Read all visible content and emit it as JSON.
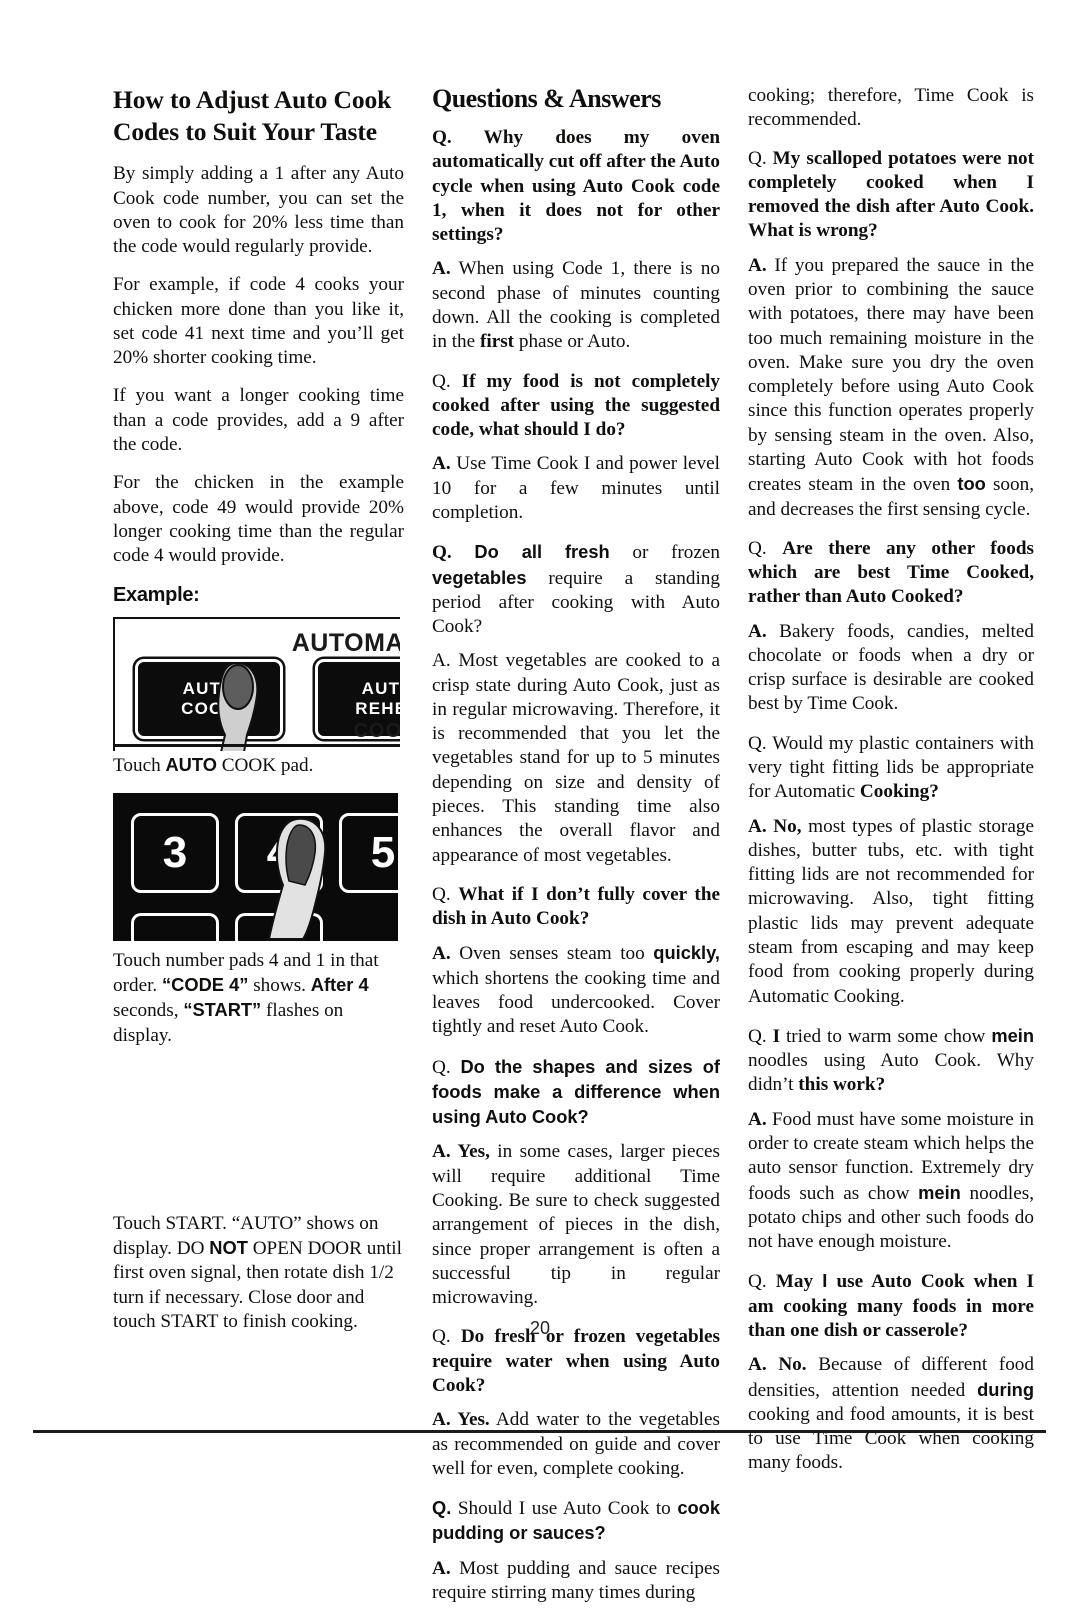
{
  "page": {
    "number": "20"
  },
  "left_column": {
    "heading": "How to Adjust Auto Cook Codes to Suit Your Taste",
    "paragraphs": [
      "By simply adding a 1 after any Auto Cook code number, you can set the oven to cook for 20% less time than the code would regularly provide.",
      "For example, if code 4 cooks your chicken more done than you like it, set code 41 next time and you’ll get 20% shorter cooking time.",
      "If you want a longer cooking time than a code provides, add a 9 after the code.",
      "For the chicken in the example above, code 49 would provide 20% longer cooking time than the regular code 4 would provide."
    ],
    "example_heading": "Example:",
    "photo1": {
      "panel_label_top": "AUTOMA",
      "panel_label_bottom": "COO",
      "pad_auto_cook_line1": "AUTO",
      "pad_auto_cook_line2": "COOK",
      "pad_auto_reheat_line1": "AUTO",
      "pad_auto_reheat_line2": "REHEA"
    },
    "caption1_part1": "Touch ",
    "caption1_bold": "AUTO",
    "caption1_part2": " COOK pad.",
    "photo2": {
      "pad3": "3",
      "pad4": "4",
      "pad5": "5"
    },
    "caption2_part1": "Touch number pads 4 and 1 in that order. ",
    "caption2_bold1": "“CODE 4”",
    "caption2_part2": " shows. ",
    "caption2_bold2": "After 4",
    "caption2_part3": " seconds, ",
    "caption2_bold3": "“START”",
    "caption2_part4": " flashes on display.",
    "final_part1": "Touch START. “AUTO” shows on display. DO ",
    "final_bold": "NOT",
    "final_part2": " OPEN DOOR until first oven signal, then rotate dish 1/2 turn if necessary. Close door and touch START to finish cooking."
  },
  "middle_column": {
    "heading": "Questions & Answers",
    "qa": [
      {
        "q_prefix": "Q. ",
        "q_text": "Why does my oven automatically cut off after the Auto cycle when using Auto Cook code 1, when it does not for other settings?",
        "a_prefix": "A.",
        "a_part1": " When using Code 1, there is no second phase of minutes counting down. All the cooking is completed in the ",
        "a_bold": "first",
        "a_part2": " phase or Auto."
      },
      {
        "q_prefix": "Q. ",
        "q_text": "If my food is not completely cooked after using the suggested code, what should I do?",
        "a_prefix": "A.",
        "a_part1": " Use Time Cook I and power level 10 for a few minutes until completion."
      },
      {
        "q_prefix": "Q. ",
        "q_bold1": "Do all fresh",
        "q_reg1": " or frozen ",
        "q_bold2": "vegetables",
        "q_reg2": " require a standing period after cooking with Auto Cook?",
        "a_text": "A. Most vegetables are cooked to a crisp state during Auto Cook, just as in regular microwaving. Therefore, it is recommended that you let the vegetables stand for up to 5 minutes depending on size and density of pieces. This standing time also enhances the overall flavor and appearance of most vegetables."
      },
      {
        "q_prefix": "Q. ",
        "q_text": "What if I don’t fully cover the dish in Auto Cook?",
        "a_prefix": "A.",
        "a_part1": " Oven senses steam too ",
        "a_bold": "quickly,",
        "a_part2": " which shortens the cooking time and leaves food undercooked. Cover tightly and reset Auto Cook."
      },
      {
        "q_prefix": "Q. ",
        "q_text": "Do the shapes and sizes of foods make a difference when using Auto Cook?",
        "a_prefix": "A. Yes,",
        "a_part1": " in some cases, larger pieces will require additional Time Cooking. Be sure to check suggested arrangement of pieces in the dish, since proper arrangement is often a successful tip in regular microwaving."
      },
      {
        "q_prefix": "Q. ",
        "q_text": "Do fresh or frozen vegetables require water when using Auto Cook?",
        "a_prefix": "A. Yes.",
        "a_part1": " Add water to the vegetables as recommended on guide and cover well for even, complete cooking."
      },
      {
        "q_prefix": "Q.",
        "q_reg1": " Should I use Auto Cook to ",
        "q_bold2": "cook pudding or sauces?",
        "a_prefix": "A.",
        "a_part1": " Most pudding and sauce recipes require stirring many times during"
      }
    ]
  },
  "right_column": {
    "continued": "cooking; therefore, Time Cook is recommended.",
    "qa": [
      {
        "q_prefix": "Q. ",
        "q_text": "My scalloped potatoes were not completely cooked when I removed the dish after Auto Cook. What is wrong?",
        "a_prefix": "A.",
        "a_part1": " If you prepared the sauce in the oven prior to combining the sauce with potatoes, there may have been too much remaining moisture in the oven. Make sure you dry the oven completely before using Auto Cook since this function operates properly by sensing steam in the oven. Also, starting Auto Cook with hot foods creates steam in the oven ",
        "a_bold": "too",
        "a_part2": " soon, and decreases the first sensing cycle."
      },
      {
        "q_prefix": "Q. ",
        "q_text": "Are there any other foods which are best Time Cooked, rather than Auto Cooked?",
        "a_prefix": "A.",
        "a_part1": " Bakery foods, candies, melted chocolate or foods when a dry or crisp surface is desirable are cooked best by Time Cook."
      },
      {
        "q_prefix": "Q.",
        "q_reg1": " Would my plastic containers with very tight fitting lids be appropriate for Automatic ",
        "q_bold2": "Cooking?",
        "a_prefix": "A. No,",
        "a_part1": " most types of plastic storage dishes, butter tubs, etc. with tight fitting lids are not recommended for microwaving. Also, tight fitting plastic lids may prevent adequate steam from escaping and may keep food from cooking properly during Automatic Cooking."
      },
      {
        "q_prefix": "Q. ",
        "q_bold1": "I",
        "q_reg1": " tried to warm some chow ",
        "q_bold2": "mein",
        "q_reg2": " noodles using Auto Cook. Why didn’t ",
        "q_bold3": "this work?",
        "a_prefix": "A.",
        "a_part1": " Food must have some moisture in order to create steam which helps the auto sensor function. Extremely dry foods such as chow ",
        "a_bold": "mein",
        "a_part2": " noodles, potato chips and other such foods do not have enough moisture."
      },
      {
        "q_prefix": "Q. ",
        "q_bold1": "May ",
        "q_bold_i": "I",
        "q_bold2": " use Auto Cook when I am cooking many foods in more than one dish or casserole?",
        "a_prefix": "A. No.",
        "a_part1": " Because of different food densities, attention needed ",
        "a_bold": "during",
        "a_part2": " cooking and food amounts, it is best to use Time Cook when cooking many foods."
      }
    ]
  }
}
